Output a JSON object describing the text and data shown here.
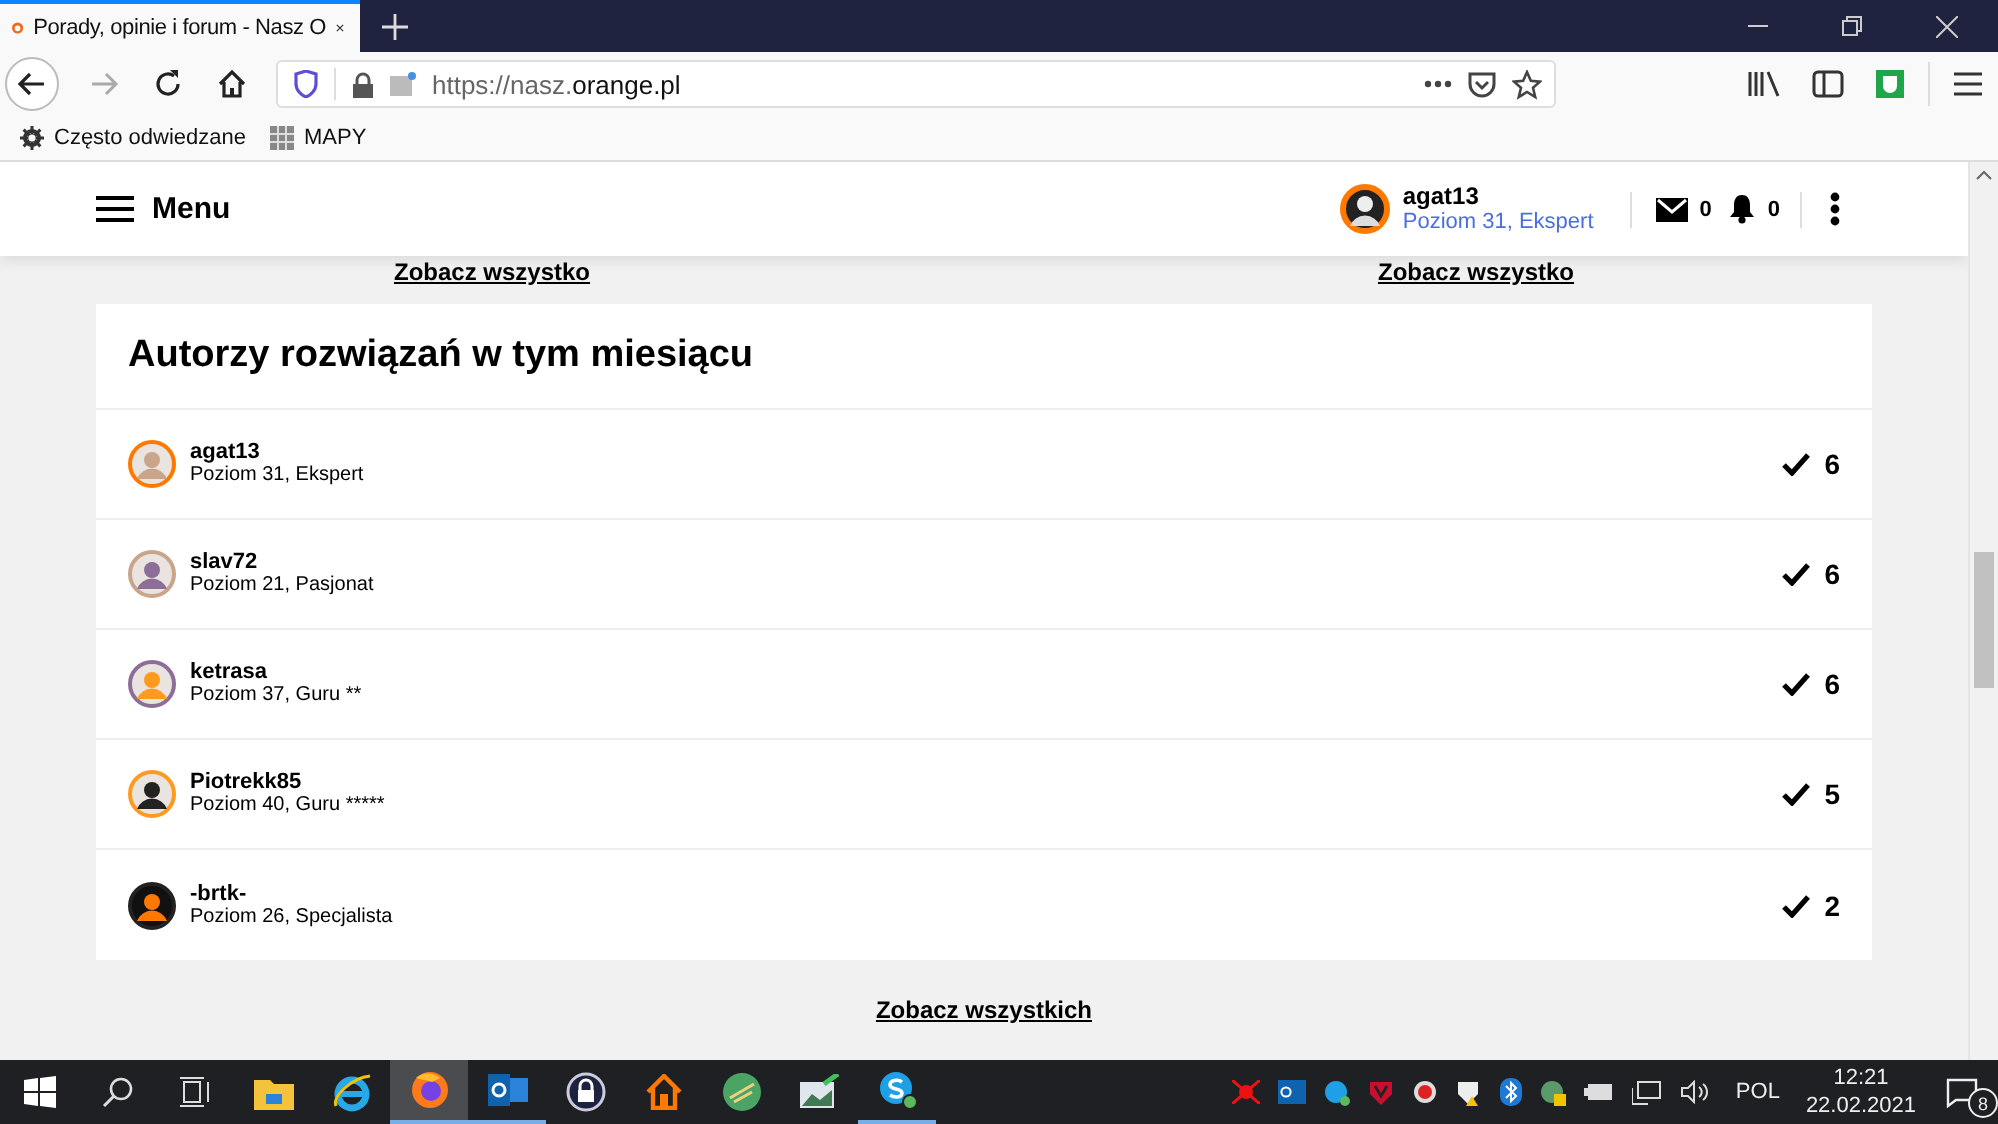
{
  "browser": {
    "tab": {
      "title": "Porady, opinie i forum - Nasz O",
      "selected": true
    },
    "url": {
      "prefix": "https://nasz.",
      "domain": "orange.pl"
    },
    "bookmarks": [
      {
        "label": "Często odwiedzane",
        "kind": "gear"
      },
      {
        "label": "MAPY",
        "kind": "grid"
      }
    ]
  },
  "header": {
    "menu_label": "Menu",
    "user": {
      "name": "agat13",
      "level": "Poziom 31, Ekspert"
    },
    "messages": "0",
    "notifications": "0"
  },
  "links_above": [
    "Zobacz wszystko",
    "Zobacz wszystko"
  ],
  "card": {
    "title": "Autorzy rozwiązań w tym miesiącu",
    "authors": [
      {
        "name": "agat13",
        "rank": "Poziom 31, Ekspert",
        "solutions": "6"
      },
      {
        "name": "slav72",
        "rank": "Poziom 21, Pasjonat",
        "solutions": "6"
      },
      {
        "name": "ketrasa",
        "rank": "Poziom 37, Guru **",
        "solutions": "6"
      },
      {
        "name": "Piotrekk85",
        "rank": "Poziom 40, Guru *****",
        "solutions": "5"
      },
      {
        "name": "-brtk-",
        "rank": "Poziom 26, Specjalista",
        "solutions": "2"
      }
    ],
    "footer_link": "Zobacz wszystkich"
  },
  "taskbar": {
    "apps": [
      {
        "kind": "explorer",
        "open": false,
        "selected": false
      },
      {
        "kind": "ie",
        "open": false,
        "selected": false
      },
      {
        "kind": "firefox",
        "open": true,
        "selected": true
      },
      {
        "kind": "outlook",
        "open": true,
        "selected": false
      },
      {
        "kind": "lock",
        "open": false,
        "selected": false
      },
      {
        "kind": "home",
        "open": false,
        "selected": false
      },
      {
        "kind": "disc",
        "open": false,
        "selected": false
      },
      {
        "kind": "image",
        "open": false,
        "selected": false
      },
      {
        "kind": "skype",
        "open": true,
        "selected": false
      }
    ],
    "language": "POL",
    "time": "12:21",
    "date": "22.02.2021",
    "notification_count": "8"
  }
}
